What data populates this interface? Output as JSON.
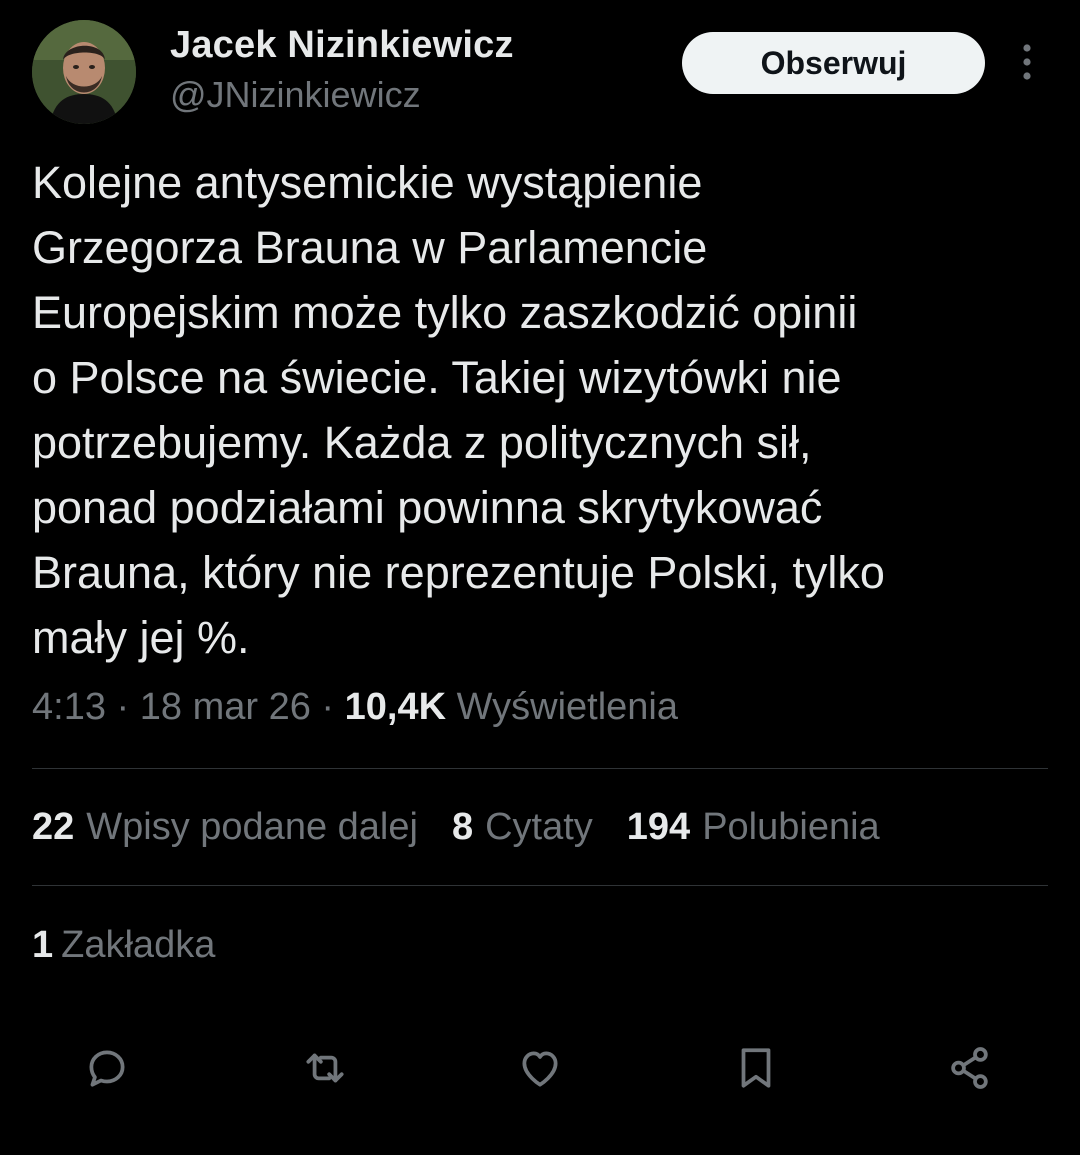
{
  "author": {
    "display_name": "Jacek Nizinkiewicz",
    "handle": "@JNizinkiewicz"
  },
  "header": {
    "follow_label": "Obserwuj"
  },
  "tweet": {
    "text": "Kolejne antysemickie wystąpienie\nGrzegorza Brauna w Parlamencie\nEuropejskim może tylko zaszkodzić opinii\no Polsce na świecie. Takiej wizytówki nie\npotrzebujemy. Każda z politycznych sił,\nponad podziałami powinna skrytykować\nBrauna, który nie reprezentuje Polski, tylko\nmały jej %.",
    "time": "4:13",
    "separator": "·",
    "date": "18 mar 26",
    "views_count": "10,4K",
    "views_label": "Wyświetlenia"
  },
  "stats": {
    "reposts_count": "22",
    "reposts_label": "Wpisy podane dalej",
    "quotes_count": "8",
    "quotes_label": "Cytaty",
    "likes_count": "194",
    "likes_label": "Polubienia",
    "bookmarks_count": "1",
    "bookmarks_label": "Zakładka"
  },
  "icons": {
    "more": "more-vertical-icon",
    "reply": "reply-icon",
    "repost": "repost-icon",
    "like": "heart-icon",
    "bookmark": "bookmark-icon",
    "share": "share-icon"
  },
  "colors": {
    "background": "#000000",
    "text_primary": "#e7e9ea",
    "text_secondary": "#71767b",
    "divider": "#2f3336",
    "follow_button_bg": "#eff3f4",
    "follow_button_text": "#0f1419"
  }
}
